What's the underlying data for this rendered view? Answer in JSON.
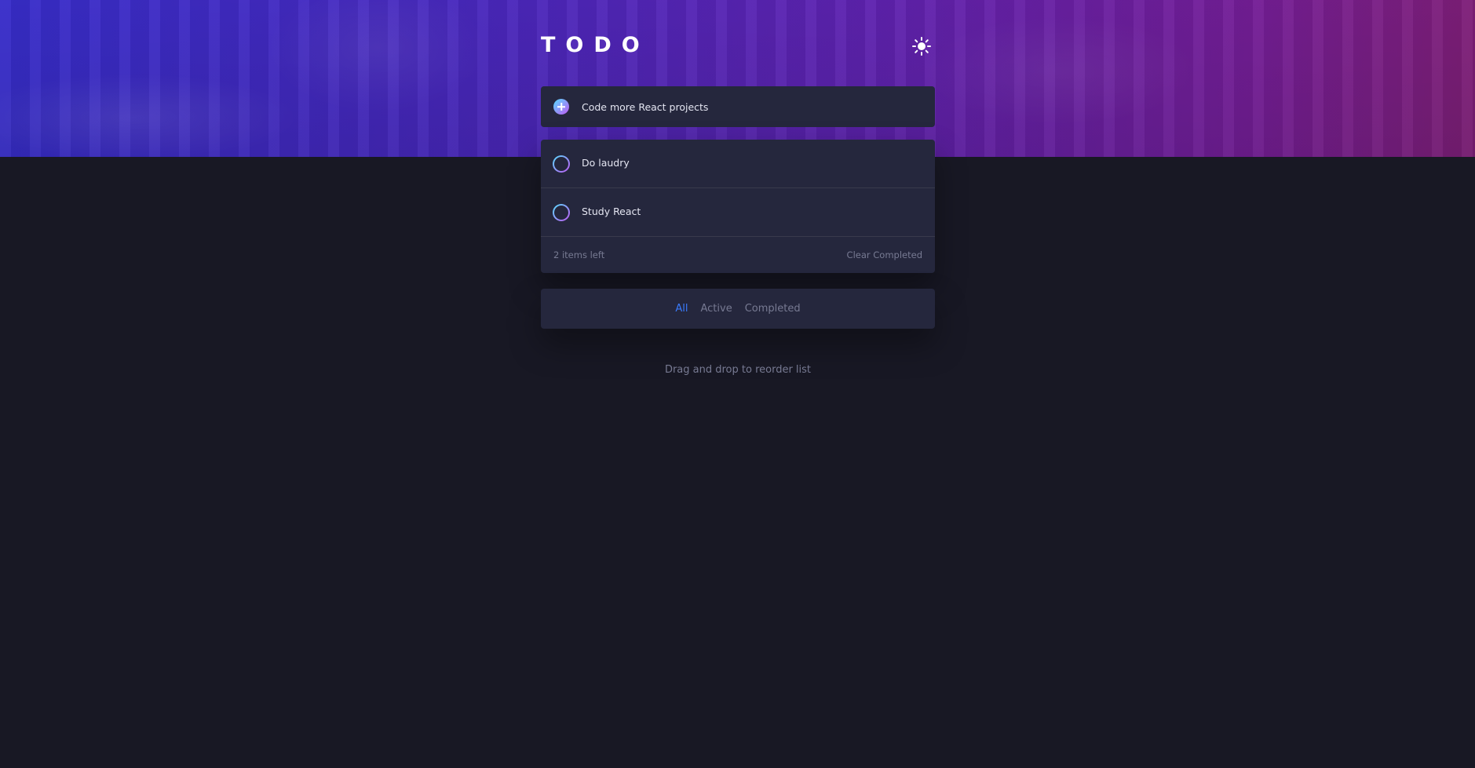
{
  "header": {
    "title": "TODO",
    "theme_toggle_icon": "sun-icon"
  },
  "new_todo": {
    "add_icon": "plus-icon",
    "placeholder": "Code more React projects",
    "value": ""
  },
  "todos": [
    {
      "text": "Do laudry",
      "completed": false
    },
    {
      "text": "Study React",
      "completed": false
    }
  ],
  "footer": {
    "items_left": "2 items left",
    "clear_completed": "Clear Completed"
  },
  "filters": {
    "all": "All",
    "active": "Active",
    "completed": "Completed",
    "selected": "All"
  },
  "hint": "Drag and drop to reorder list",
  "colors": {
    "background": "#181824",
    "card": "#25273d",
    "text": "#e4e5f1",
    "muted": "#777a92",
    "accent": "#3a7bfd",
    "check_gradient_start": "#57ddff",
    "check_gradient_end": "#c058f3"
  }
}
